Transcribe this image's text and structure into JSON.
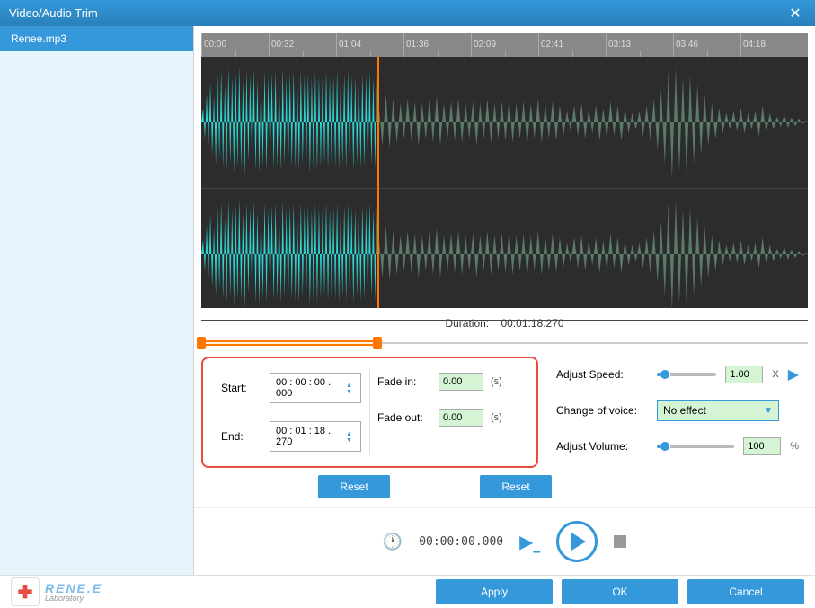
{
  "titlebar": {
    "title": "Video/Audio Trim"
  },
  "sidebar": {
    "file": "Renee.mp3"
  },
  "ruler": {
    "ticks": [
      "00:00",
      "00:32",
      "01:04",
      "01:36",
      "02:09",
      "02:41",
      "03:13",
      "03:46",
      "04:18"
    ]
  },
  "duration": {
    "label": "Duration:",
    "value": "00:01:18.270"
  },
  "trim": {
    "start_label": "Start:",
    "start_value": "00 : 00 : 00 . 000",
    "end_label": "End:",
    "end_value": "00 : 01 : 18 . 270",
    "fadein_label": "Fade in:",
    "fadein_value": "0.00",
    "fadeout_label": "Fade out:",
    "fadeout_value": "0.00",
    "seconds_unit": "(s)",
    "reset_label": "Reset"
  },
  "params": {
    "speed_label": "Adjust Speed:",
    "speed_value": "1.00",
    "speed_unit": "X",
    "voice_label": "Change of voice:",
    "voice_value": "No effect",
    "volume_label": "Adjust Volume:",
    "volume_value": "100",
    "volume_unit": "%"
  },
  "playback": {
    "time": "00:00:00.000"
  },
  "footer": {
    "logo_main": "RENE.E",
    "logo_sub": "Laboratory",
    "apply": "Apply",
    "ok": "OK",
    "cancel": "Cancel"
  },
  "colors": {
    "accent": "#3498db",
    "highlight": "#ff7700",
    "danger": "#e74c3c"
  }
}
